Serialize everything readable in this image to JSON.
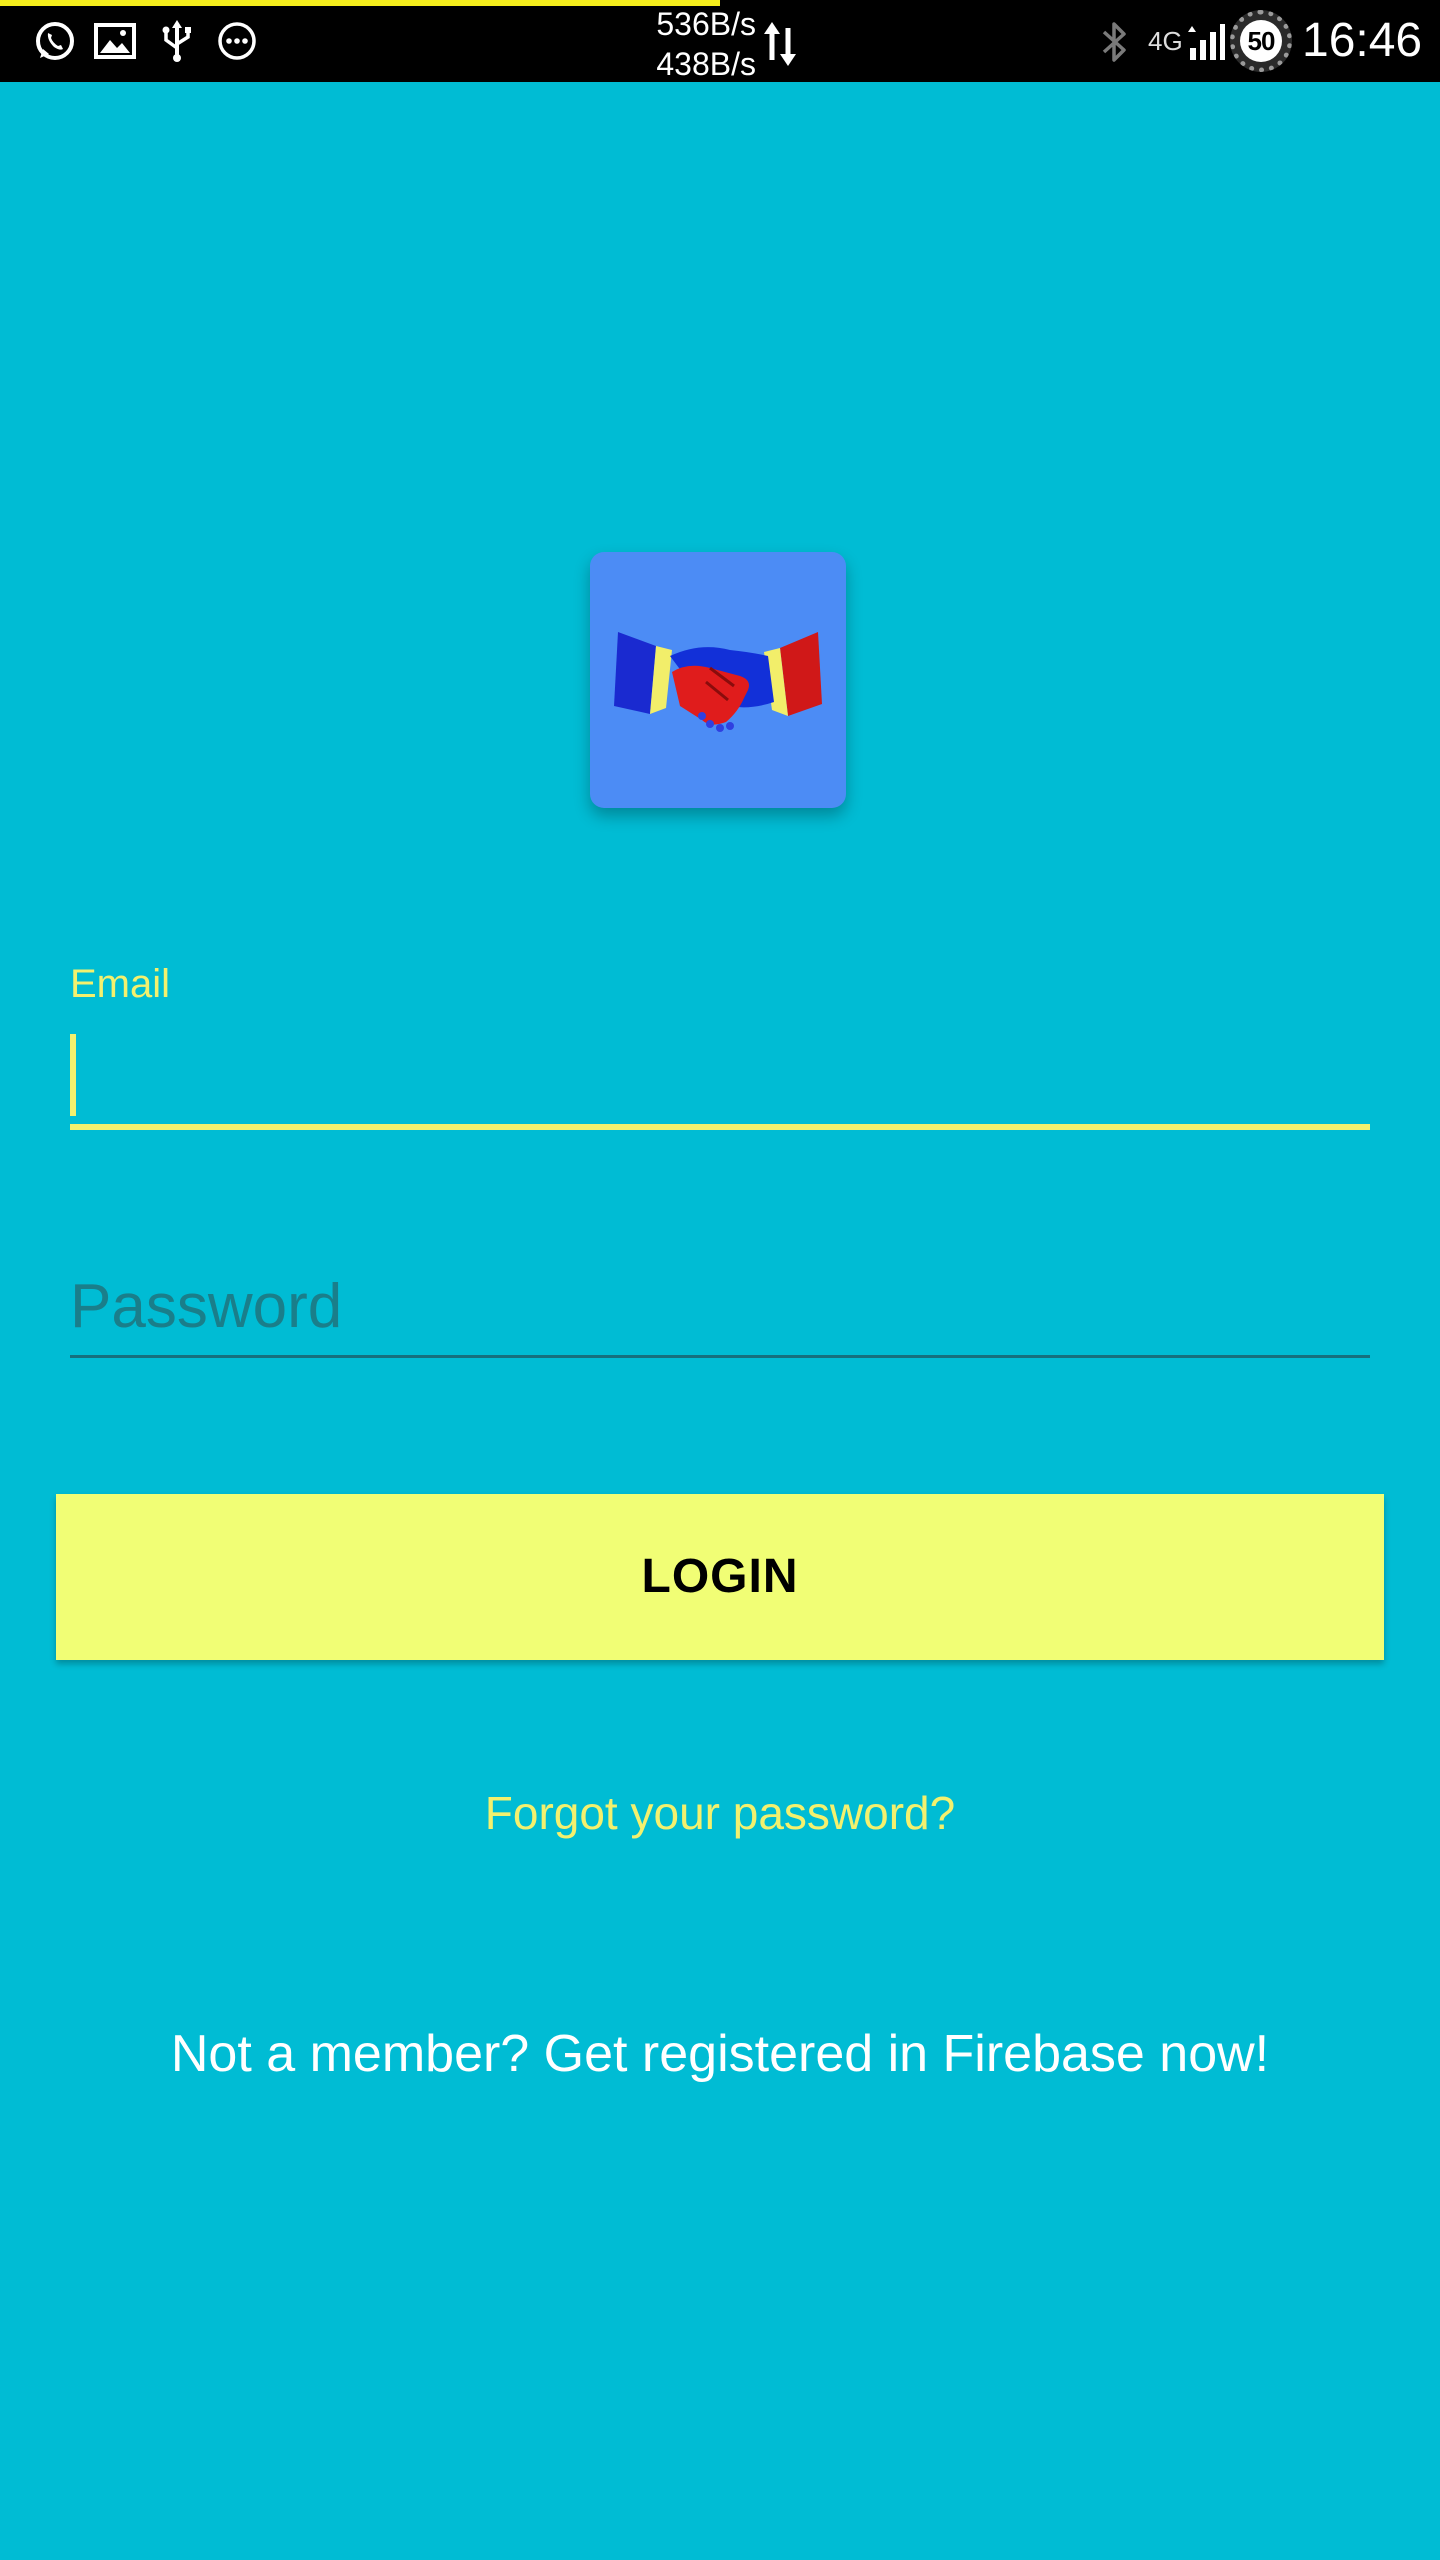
{
  "status_bar": {
    "upload_speed": "536B/s",
    "download_speed": "438B/s",
    "network_type": "4G",
    "battery_level": "50",
    "time": "16:46",
    "progress_fraction": 0.5,
    "progress_color": "#F4EE1C",
    "left_icons": [
      "whatsapp-icon",
      "gallery-icon",
      "usb-icon",
      "more-dots-icon"
    ],
    "right_icons": [
      "bluetooth-icon",
      "signal-icon",
      "battery-ring-icon"
    ]
  },
  "app": {
    "logo_icon": "handshake-icon",
    "background_color": "#00BCD4",
    "accent_color": "#F3F16E"
  },
  "form": {
    "email": {
      "label": "Email",
      "value": ""
    },
    "password": {
      "placeholder": "Password",
      "value": ""
    },
    "login_label": "LOGIN",
    "forgot_password_label": "Forgot your password?",
    "register_label": "Not a member? Get registered in Firebase now!"
  }
}
